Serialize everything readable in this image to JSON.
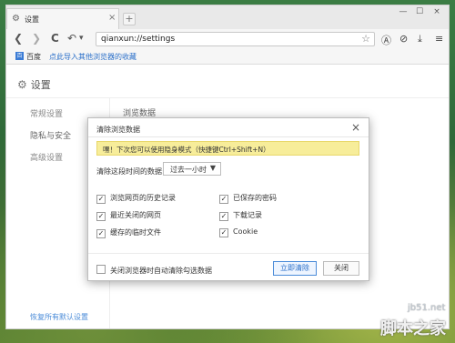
{
  "tab": {
    "title": "设置",
    "close": "×",
    "new": "+"
  },
  "window": {
    "min": "—",
    "max": "☐",
    "close": "×"
  },
  "toolbar": {
    "back": "❮",
    "forward": "❯",
    "reload": "C",
    "undo": "↶",
    "undo_dropdown": "▾",
    "url": "qianxun://settings",
    "star": "☆",
    "icons": {
      "a": "Ⓐ",
      "o": "⊘",
      "dl": "⤓",
      "menu": "≡"
    }
  },
  "bookmarks": {
    "icon": "百",
    "label": "百度",
    "import": "点此导入其他浏览器的收藏"
  },
  "page": {
    "title": "设置",
    "nav": [
      "常规设置",
      "隐私与安全",
      "高级设置"
    ],
    "section": "浏览数据",
    "restore": "恢复所有默认设置"
  },
  "dialog": {
    "title": "清除浏览数据",
    "close": "×",
    "tip": "嘿！下次您可以使用隐身模式（快捷键Ctrl+Shift+N）",
    "range_label": "清除这段时间的数据:",
    "range_value": "过去一小时",
    "options": [
      {
        "label": "浏览网页的历史记录",
        "checked": true
      },
      {
        "label": "最近关闭的网页",
        "checked": true
      },
      {
        "label": "缓存的临时文件",
        "checked": true
      },
      {
        "label": "已保存的密码",
        "checked": true
      },
      {
        "label": "下载记录",
        "checked": true
      },
      {
        "label": "Cookie",
        "checked": true
      }
    ],
    "auto_clear": "关闭浏览器时自动清除勾选数据",
    "auto_clear_checked": false,
    "clear_button": "立即清除",
    "close_button": "关闭"
  },
  "watermark": {
    "site": "jb51.net",
    "name": "脚本之家"
  }
}
